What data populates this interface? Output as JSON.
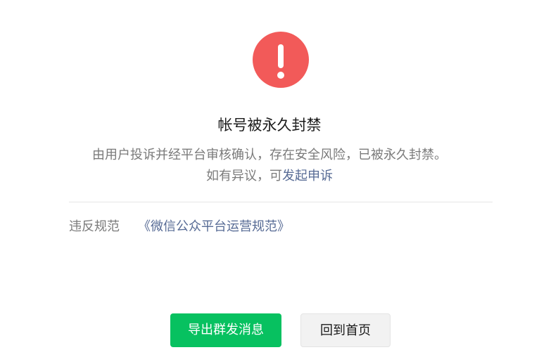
{
  "notice": {
    "icon": "exclamation-circle-icon",
    "icon_color": "#f25a59",
    "title": "帐号被永久封禁",
    "description": "由用户投诉并经平台审核确认，存在安全风险，已被永久封禁。",
    "appeal_prefix": "如有异议，可",
    "appeal_link": "发起申诉"
  },
  "violation": {
    "label": "违反规范",
    "rule_link": "《微信公众平台运营规范》"
  },
  "actions": {
    "export_label": "导出群发消息",
    "home_label": "回到首页"
  },
  "colors": {
    "primary": "#07c160",
    "link": "#576b95",
    "danger": "#f25a59"
  }
}
